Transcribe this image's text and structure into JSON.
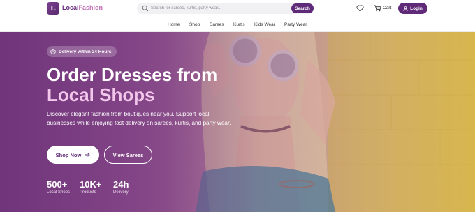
{
  "brand": {
    "initial": "L",
    "name_part1": "Local",
    "name_part2": "Fashion"
  },
  "search": {
    "placeholder": "Search for sarees, kurtis, party wear...",
    "button": "Search"
  },
  "header": {
    "cart_label": "Cart",
    "login_label": "Login"
  },
  "nav": [
    "Home",
    "Shop",
    "Sarees",
    "Kurtis",
    "Kids Wear",
    "Party Wear"
  ],
  "hero": {
    "badge": "Delivery within 24 Hours",
    "title_line1": "Order Dresses from",
    "title_line2": "Local Shops",
    "description": "Discover elegant fashion from boutiques near you. Support local businesses while enjoying fast delivery on sarees, kurtis, and party wear.",
    "primary_button": "Shop Now",
    "secondary_button": "View Sarees",
    "stats": [
      {
        "value": "500+",
        "label": "Local Shops"
      },
      {
        "value": "10K+",
        "label": "Products"
      },
      {
        "value": "24h",
        "label": "Delivery"
      }
    ]
  },
  "colors": {
    "primary": "#5f2a78",
    "accent_pink": "#f3c6ec",
    "hero_yellow": "#d6b54a"
  },
  "icons": [
    "search-icon",
    "heart-icon",
    "cart-icon",
    "user-icon",
    "clock-icon",
    "arrow-right-icon"
  ]
}
